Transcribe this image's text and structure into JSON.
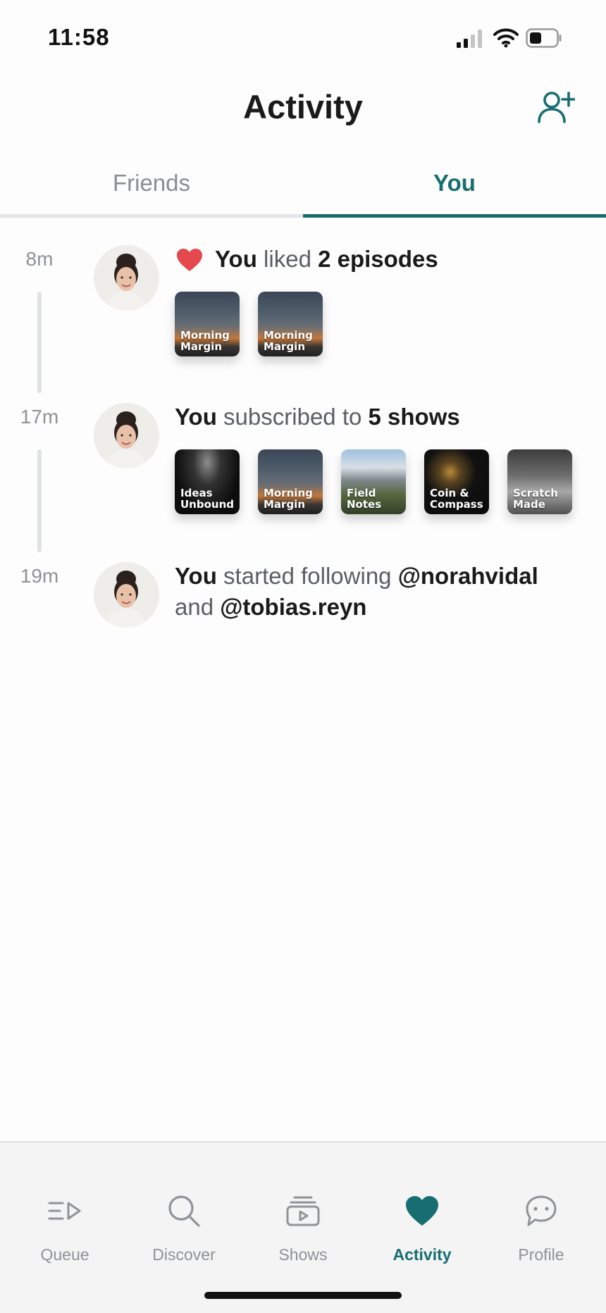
{
  "status_bar": {
    "time": "11:58"
  },
  "header": {
    "title": "Activity"
  },
  "tabs": [
    {
      "label": "Friends",
      "active": false
    },
    {
      "label": "You",
      "active": true
    }
  ],
  "feed": [
    {
      "time": "8m",
      "text_parts": [
        {
          "text": "You",
          "bold": true
        },
        {
          "text": " liked ",
          "bold": false
        },
        {
          "text": "2 episodes",
          "bold": true
        }
      ],
      "icon": "heart-icon",
      "items": [
        {
          "label": "Morning\nMargin",
          "art": "bg-morning"
        },
        {
          "label": "Morning\nMargin",
          "art": "bg-morning"
        }
      ]
    },
    {
      "time": "17m",
      "text_parts": [
        {
          "text": "You",
          "bold": true
        },
        {
          "text": " subscribed to ",
          "bold": false
        },
        {
          "text": "5 shows",
          "bold": true
        }
      ],
      "items": [
        {
          "label": "Ideas\nUnbound",
          "art": "bg-ideas"
        },
        {
          "label": "Morning\nMargin",
          "art": "bg-morning"
        },
        {
          "label": "Field\nNotes",
          "art": "bg-field"
        },
        {
          "label": "Coin &\nCompass",
          "art": "bg-coin"
        },
        {
          "label": "Scratch\nMade",
          "art": "bg-scratch"
        }
      ]
    },
    {
      "time": "19m",
      "text_parts": [
        {
          "text": "You",
          "bold": true
        },
        {
          "text": " started following ",
          "bold": false
        },
        {
          "text": "@norahvidal",
          "bold": true
        },
        {
          "text": " and ",
          "bold": false
        },
        {
          "text": "@tobias.reyn",
          "bold": true
        }
      ]
    }
  ],
  "bottom_nav": [
    {
      "label": "Queue",
      "icon": "queue-icon",
      "active": false
    },
    {
      "label": "Discover",
      "icon": "search-icon",
      "active": false
    },
    {
      "label": "Shows",
      "icon": "shows-icon",
      "active": false
    },
    {
      "label": "Activity",
      "icon": "heart-icon",
      "active": true
    },
    {
      "label": "Profile",
      "icon": "chat-bubble-icon",
      "active": false
    }
  ],
  "colors": {
    "accent": "#176e70",
    "like_heart": "#e5484d",
    "inactive_text": "#8f9296"
  }
}
